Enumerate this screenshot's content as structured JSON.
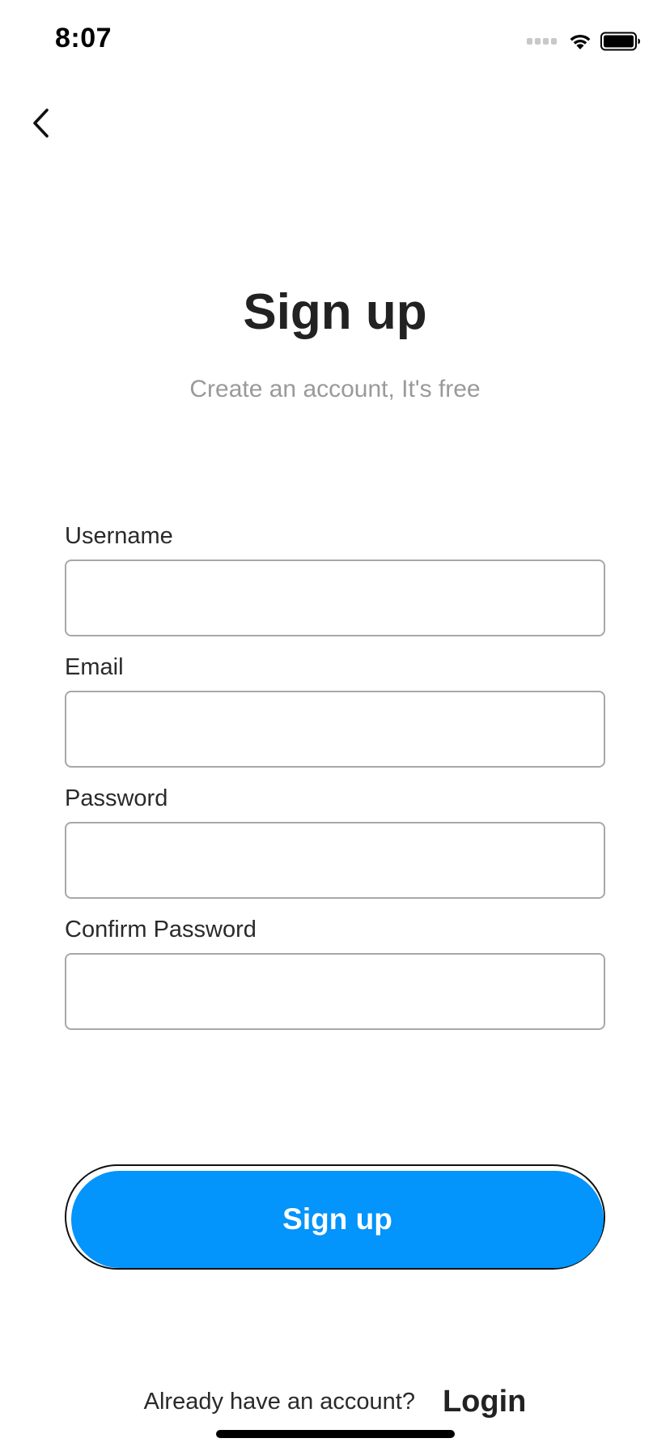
{
  "status_bar": {
    "time": "8:07",
    "signal_icon": "signal-dots-icon",
    "wifi_icon": "wifi-icon",
    "battery_icon": "battery-icon"
  },
  "nav": {
    "back_icon": "chevron-left-icon"
  },
  "header": {
    "title": "Sign up",
    "subtitle": "Create an account, It's free"
  },
  "form": {
    "username": {
      "label": "Username",
      "value": ""
    },
    "email": {
      "label": "Email",
      "value": ""
    },
    "password": {
      "label": "Password",
      "value": ""
    },
    "confirm_password": {
      "label": "Confirm Password",
      "value": ""
    }
  },
  "actions": {
    "signup_label": "Sign up"
  },
  "footer": {
    "prompt": "Already have an account?",
    "login_label": "Login"
  },
  "colors": {
    "primary": "#0394fc",
    "title": "#222222",
    "subtitle": "#9a9a9a",
    "input_border": "#a8a8a8"
  }
}
